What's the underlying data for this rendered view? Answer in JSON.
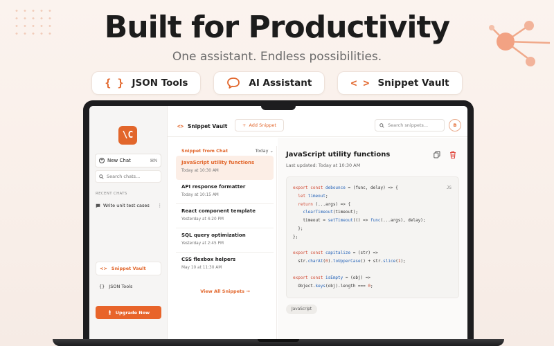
{
  "hero": {
    "title": "Built for Productivity",
    "subtitle": "One assistant. Endless possibilities."
  },
  "pills": [
    {
      "icon": "braces-icon",
      "glyph": "{ }",
      "label": "JSON Tools"
    },
    {
      "icon": "chat-bubble-icon",
      "glyph": "◯",
      "label": "AI Assistant"
    },
    {
      "icon": "code-icon",
      "glyph": "< >",
      "label": "Snippet Vault"
    }
  ],
  "sidebar": {
    "logo": "\\C",
    "new_chat": "New Chat",
    "new_chat_shortcut": "⌘N",
    "search_placeholder": "Search chats...",
    "recent_heading": "RECENT CHATS",
    "recent_items": [
      "Write unit test cases"
    ],
    "nav": [
      {
        "glyph": "<>",
        "label": "Snippet Vault"
      },
      {
        "glyph": "{}",
        "label": "JSON Tools"
      }
    ],
    "upgrade": "Upgrade Now"
  },
  "topbar": {
    "glyph": "<>",
    "title": "Snippet Vault",
    "add_label": "Add Snippet",
    "search_placeholder": "Search snippets...",
    "avatar": "B"
  },
  "list": {
    "heading": "Snippet from Chat",
    "filter": "Today",
    "items": [
      {
        "name": "JavaScript utility functions",
        "date": "Today at 10:30 AM"
      },
      {
        "name": "API response formatter",
        "date": "Today at 10:15 AM"
      },
      {
        "name": "React component template",
        "date": "Yesterday at 4:20 PM"
      },
      {
        "name": "SQL query optimization",
        "date": "Yesterday at 2:45 PM"
      },
      {
        "name": "CSS flexbox helpers",
        "date": "May 10 at 11:30 AM"
      }
    ],
    "view_all": "View All Snippets"
  },
  "detail": {
    "title": "JavaScript utility functions",
    "updated": "Last updated: Today at 10:30 AM",
    "lang": "JS",
    "tag": "JavaScript"
  },
  "colors": {
    "accent": "#e2662b",
    "danger": "#e0443a"
  }
}
